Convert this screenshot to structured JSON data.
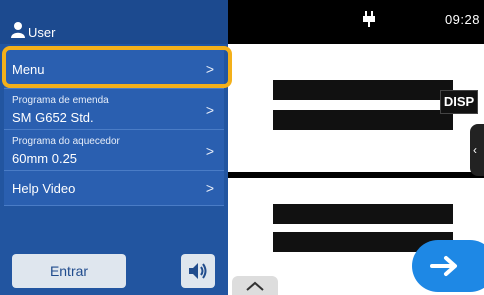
{
  "status": {
    "time": "09:28"
  },
  "user": {
    "label": "User"
  },
  "menu": {
    "items": [
      {
        "main": "Menu",
        "sub": "",
        "chevron": ">"
      },
      {
        "main": "SM G652 Std.",
        "sub": "Programa de emenda",
        "chevron": ">"
      },
      {
        "main": "60mm 0.25",
        "sub": "Programa do aquecedor",
        "chevron": ">"
      },
      {
        "main": "Help Video",
        "sub": "",
        "chevron": ">"
      }
    ]
  },
  "buttons": {
    "entrar": "Entrar",
    "disp": "DISP"
  },
  "icons": {
    "user": "user-icon",
    "plug": "plug-icon",
    "sound": "speaker-icon",
    "next": "arrow-right-icon",
    "side_tab": "chevron-left-icon",
    "bottom": "chevron-up-icon"
  },
  "colors": {
    "accent": "#f3b01a",
    "menu_bg": "#2255a0",
    "next_button": "#1e88e5"
  }
}
